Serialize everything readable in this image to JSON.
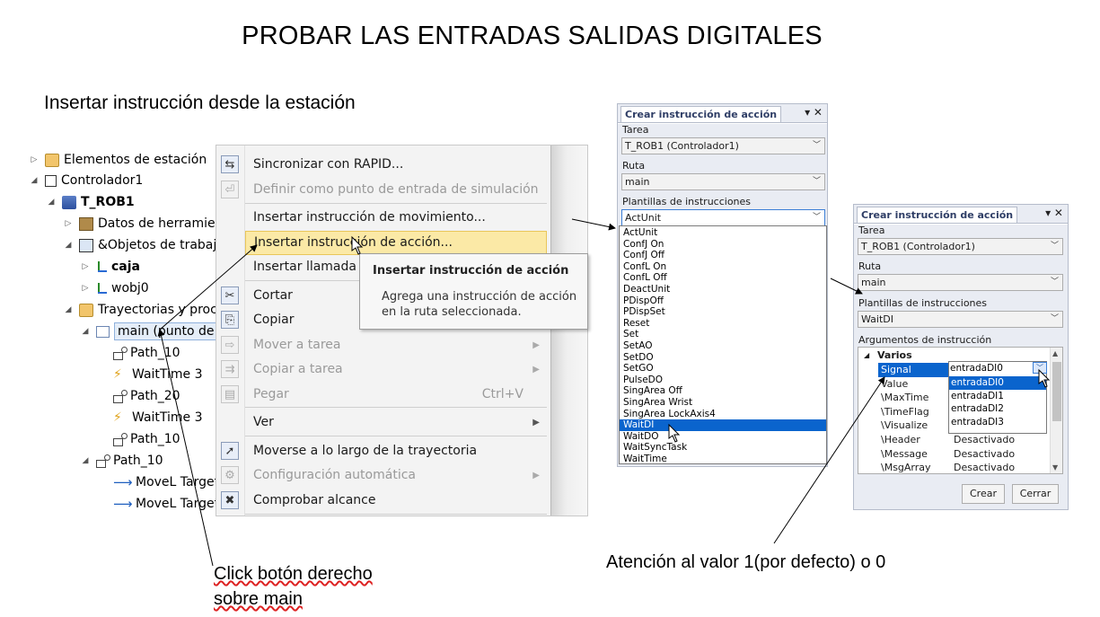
{
  "slide": {
    "title": "PROBAR LAS ENTRADAS SALIDAS DIGITALES",
    "subtitle": "Insertar instrucción  desde la estación",
    "note_left_line1": "Click botón derecho",
    "note_left_line2": "sobre main",
    "note_right": "Atención al valor   1(por defecto) o  0"
  },
  "tree": {
    "items": [
      {
        "label": "Elementos de estación",
        "icon": "folder-icon",
        "toggle": "▷"
      },
      {
        "label": "Controlador1",
        "icon": "controller-icon",
        "toggle": "◢"
      },
      {
        "label": "T_ROB1",
        "icon": "robot-task-icon",
        "toggle": "◢"
      },
      {
        "label": "Datos de herramienta",
        "icon": "tool-data-icon",
        "toggle": "▷"
      },
      {
        "label": "&Objetos de trabajo y",
        "icon": "workobject-icon",
        "toggle": "◢"
      },
      {
        "label": "caja",
        "icon": "frame-axis-icon",
        "toggle": "▷"
      },
      {
        "label": "wobj0",
        "icon": "frame-axis-icon",
        "toggle": "▷"
      },
      {
        "label": "Trayectorias y proced",
        "icon": "paths-folder-icon",
        "toggle": "◢"
      },
      {
        "label": "main (punto de en",
        "icon": "procedure-icon",
        "toggle": "◢"
      },
      {
        "label": "Path_10",
        "icon": "target-icon",
        "toggle": ""
      },
      {
        "label": "WaitTime 3",
        "icon": "wait-icon",
        "toggle": ""
      },
      {
        "label": "Path_20",
        "icon": "target-icon",
        "toggle": ""
      },
      {
        "label": "WaitTime 3",
        "icon": "wait-icon",
        "toggle": ""
      },
      {
        "label": "Path_10",
        "icon": "target-icon",
        "toggle": ""
      },
      {
        "label": "Path_10",
        "icon": "path-icon",
        "toggle": "◢"
      },
      {
        "label": "MoveL Target_",
        "icon": "movel-icon",
        "toggle": ""
      },
      {
        "label": "MoveL Target_",
        "icon": "movel-icon",
        "toggle": ""
      }
    ]
  },
  "context_menu": {
    "items": [
      {
        "label": "Sincronizar con RAPID...",
        "icon": "sync-rapid-icon",
        "enabled": true,
        "shortcut": "",
        "submenu": false
      },
      {
        "label": "Definir como punto de entrada de simulación",
        "icon": "entry-point-icon",
        "enabled": false,
        "shortcut": "",
        "submenu": false
      },
      {
        "label": "Insertar instrucción de movimiento...",
        "icon": "",
        "enabled": true,
        "shortcut": "",
        "submenu": false
      },
      {
        "label": "Insertar instrucción de acción...",
        "icon": "",
        "enabled": true,
        "shortcut": "",
        "submenu": false,
        "highlighted": true
      },
      {
        "label": "Insertar llamada a",
        "icon": "",
        "enabled": true,
        "shortcut": "",
        "submenu": false
      },
      {
        "label": "Cortar",
        "icon": "scissors-icon",
        "enabled": true,
        "shortcut": "",
        "submenu": false
      },
      {
        "label": "Copiar",
        "icon": "copy-icon",
        "enabled": true,
        "shortcut": "",
        "submenu": false
      },
      {
        "label": "Mover a tarea",
        "icon": "move-to-task-icon",
        "enabled": false,
        "shortcut": "",
        "submenu": true
      },
      {
        "label": "Copiar a tarea",
        "icon": "copy-to-task-icon",
        "enabled": false,
        "shortcut": "",
        "submenu": true
      },
      {
        "label": "Pegar",
        "icon": "paste-icon",
        "enabled": false,
        "shortcut": "Ctrl+V",
        "submenu": false
      },
      {
        "label": "Ver",
        "icon": "",
        "enabled": true,
        "shortcut": "",
        "submenu": true
      },
      {
        "label": "Moverse a lo largo de la trayectoria",
        "icon": "move-along-path-icon",
        "enabled": true,
        "shortcut": "",
        "submenu": false
      },
      {
        "label": "Configuración automática",
        "icon": "auto-config-icon",
        "enabled": false,
        "shortcut": "",
        "submenu": true
      },
      {
        "label": "Comprobar alcance",
        "icon": "check-reach-icon",
        "enabled": true,
        "shortcut": "",
        "submenu": false
      }
    ],
    "tooltip": {
      "title": "Insertar instrucción de acción",
      "body": "Agrega una instrucción de acción en la ruta seleccionada."
    }
  },
  "panel1": {
    "tab": "Crear instrucción de acción",
    "tab_tools": "▾ ✕",
    "tarea_label": "Tarea",
    "tarea_value": "T_ROB1 (Controlador1)",
    "ruta_label": "Ruta",
    "ruta_value": "main",
    "plantillas_label": "Plantillas de instrucciones",
    "plantillas_value": "ActUnit",
    "options": [
      "ActUnit",
      "ConfJ On",
      "ConfJ Off",
      "ConfL On",
      "ConfL Off",
      "DeactUnit",
      "PDispOff",
      "PDispSet",
      "Reset",
      "Set",
      "SetAO",
      "SetDO",
      "SetGO",
      "PulseDO",
      "SingArea Off",
      "SingArea Wrist",
      "SingArea LockAxis4",
      "WaitDI",
      "WaitDO",
      "WaitSyncTask",
      "WaitTime"
    ],
    "selected_option": "WaitDI"
  },
  "panel2": {
    "tab": "Crear instrucción de acción",
    "tab_tools": "▾ ✕",
    "tarea_label": "Tarea",
    "tarea_value": "T_ROB1 (Controlador1)",
    "ruta_label": "Ruta",
    "ruta_value": "main",
    "plantillas_label": "Plantillas de instrucciones",
    "plantillas_value": "WaitDI",
    "args_label": "Argumentos de instrucción",
    "category": "Varios",
    "rows": [
      {
        "name": "Signal",
        "value": "entradaDI0"
      },
      {
        "name": "Value",
        "value": ""
      },
      {
        "name": "\\MaxTime",
        "value": ""
      },
      {
        "name": "\\TimeFlag",
        "value": ""
      },
      {
        "name": "\\Visualize",
        "value": ""
      },
      {
        "name": "\\Header",
        "value": "Desactivado"
      },
      {
        "name": "\\Message",
        "value": "Desactivado"
      },
      {
        "name": "\\MsgArray",
        "value": "Desactivado"
      }
    ],
    "signal_options": [
      "entradaDI0",
      "entradaDI1",
      "entradaDI2",
      "entradaDI3"
    ],
    "signal_selected": "entradaDI0",
    "create_button": "Crear",
    "close_button": "Cerrar"
  },
  "colors": {
    "menu_highlight": "#fbe9a6",
    "selection_blue": "#0a64cd",
    "panel_bg": "#e9ecf3"
  }
}
